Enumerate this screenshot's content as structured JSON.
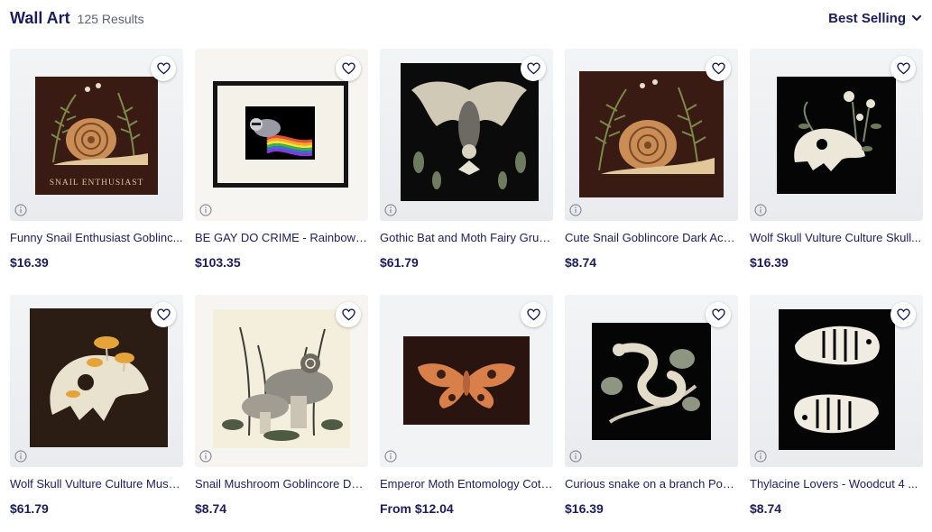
{
  "header": {
    "title": "Wall Art",
    "result_count": "125 Results",
    "sort_label": "Best Selling"
  },
  "products": [
    {
      "name": "Funny Snail Enthusiast Goblinc...",
      "price": "$16.39",
      "art_text": "SNAIL ENTHUSIAST"
    },
    {
      "name": "BE GAY DO CRIME - Rainbow Fl...",
      "price": "$103.35"
    },
    {
      "name": "Gothic Bat and Moth Fairy Grun...",
      "price": "$61.79"
    },
    {
      "name": "Cute Snail Goblincore Dark Aca...",
      "price": "$8.74"
    },
    {
      "name": "Wolf Skull Vulture Culture Skull...",
      "price": "$16.39"
    },
    {
      "name": "Wolf Skull Vulture Culture Mush...",
      "price": "$61.79"
    },
    {
      "name": "Snail Mushroom Goblincore Dar...",
      "price": "$8.74"
    },
    {
      "name": "Emperor Moth Entomology Cott...",
      "price": "From $12.04"
    },
    {
      "name": "Curious snake on a branch Post...",
      "price": "$16.39"
    },
    {
      "name": "Thylacine Lovers - Woodcut 4 ...",
      "price": "$8.74"
    }
  ],
  "icons": {
    "favorite": "heart-icon",
    "info": "info-icon",
    "sort": "chevron-down-icon"
  },
  "colors": {
    "text_primary": "#1c1d5c",
    "text_secondary": "#5e6077"
  }
}
